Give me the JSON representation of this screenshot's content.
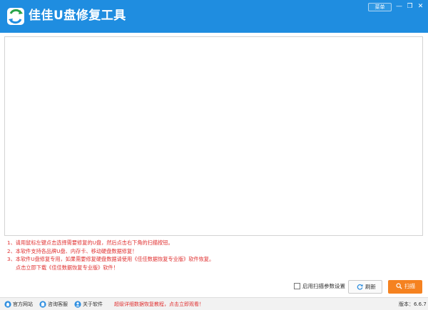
{
  "window": {
    "title": "佳佳U盘修复工具",
    "menu_label": "菜单",
    "minimize_glyph": "—",
    "maximize_glyph": "❐",
    "close_glyph": "✕"
  },
  "notes": [
    "1、请用鼠标左键点击选择需要修复的U盘，然后点击右下角的扫描按钮。",
    "2、本软件支持各品牌U盘、内存卡、移动硬盘数据修复！",
    "3、本软件U盘修复专用，如果需要修复硬盘数据请使用《佳佳数据恢复专业版》软件恢复。",
    "点击立即下载《佳佳数据恢复专业版》软件！"
  ],
  "options": {
    "scan_settings_label": "启用扫描参数设置",
    "scan_settings_checked": false
  },
  "buttons": {
    "refresh_label": "刷新",
    "scan_label": "扫描"
  },
  "footer": {
    "website_label": "官方网站",
    "support_label": "咨询客服",
    "about_label": "关于软件",
    "promo_text": "超级详细数据恢复教程，点击立即观看！",
    "version_text": "版本：6.6.7"
  },
  "colors": {
    "titlebar": "#1f8de0",
    "accent_orange": "#f58220",
    "notice_red": "#e03131"
  },
  "icons": {
    "logo": "usb-repair-logo-icon",
    "refresh": "refresh-icon",
    "scan": "search-icon",
    "website": "home-icon",
    "support": "chat-icon",
    "about": "user-icon"
  }
}
